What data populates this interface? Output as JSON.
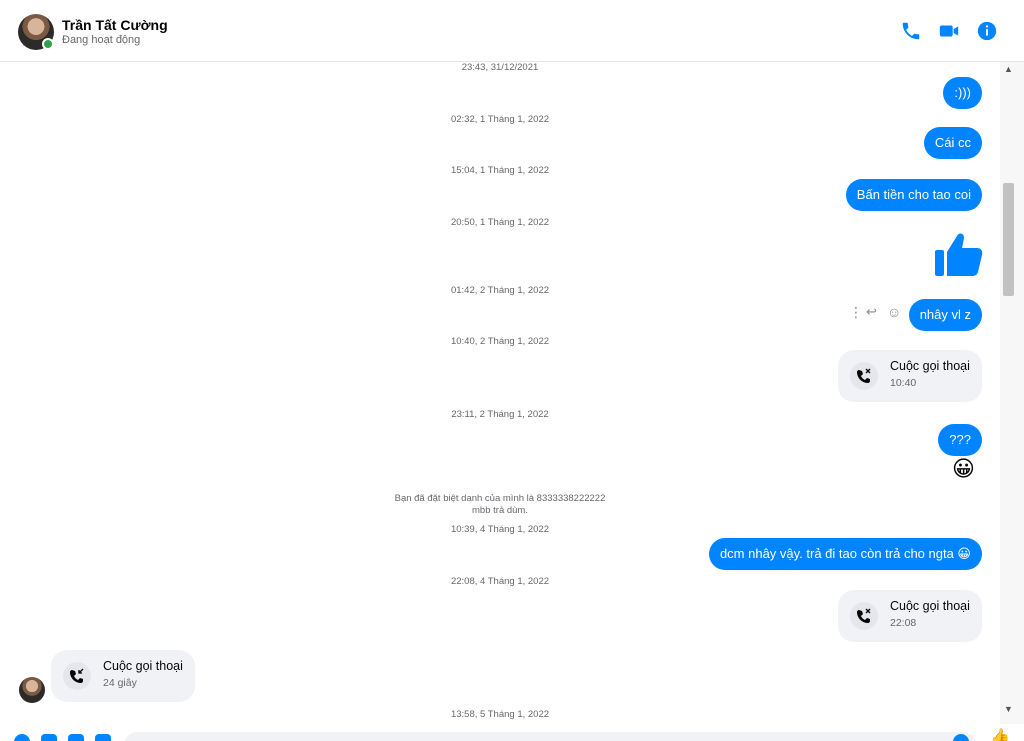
{
  "header": {
    "name": "Trần Tất Cường",
    "status": "Đang hoạt động",
    "icons": [
      "phone-icon",
      "video-camera-icon",
      "info-icon"
    ]
  },
  "colors": {
    "accent": "#0084ff",
    "bubble_gray": "#f0f2f5",
    "online": "#31a24c"
  },
  "messages": {
    "ts1": "23:43, 31/12/2021",
    "msg1": ":)))",
    "ts2": "02:32, 1 Tháng 1, 2022",
    "msg2": "Cái cc",
    "ts3": "15:04, 1 Tháng 1, 2022",
    "msg3": "Bấn tiền cho tao coi",
    "ts4": "20:50, 1 Tháng 1, 2022",
    "msg4_icon": "thumbs-up-icon",
    "ts5": "01:42, 2 Tháng 1, 2022",
    "msg5": "nhây vl z",
    "ts6": "10:40, 2 Tháng 1, 2022",
    "call1_title": "Cuộc gọi thoại",
    "call1_sub": "10:40",
    "ts7": "23:11, 2 Tháng 1, 2022",
    "msg7": "???",
    "msg7_emoji": "😀",
    "note_line1": "Bạn đã đặt biệt danh của mình là 8333338222222",
    "note_line2": "mbb trả dùm.",
    "ts8": "10:39, 4 Tháng 1, 2022",
    "msg8": "dcm nhây vậy. trả đi tao còn trả cho ngta 😀",
    "ts9": "22:08, 4 Tháng 1, 2022",
    "call2_title": "Cuộc gọi thoại",
    "call2_sub": "22:08",
    "call3_title": "Cuộc gọi thoại",
    "call3_sub": "24 giây",
    "ts10": "13:58, 5 Tháng 1, 2022"
  }
}
